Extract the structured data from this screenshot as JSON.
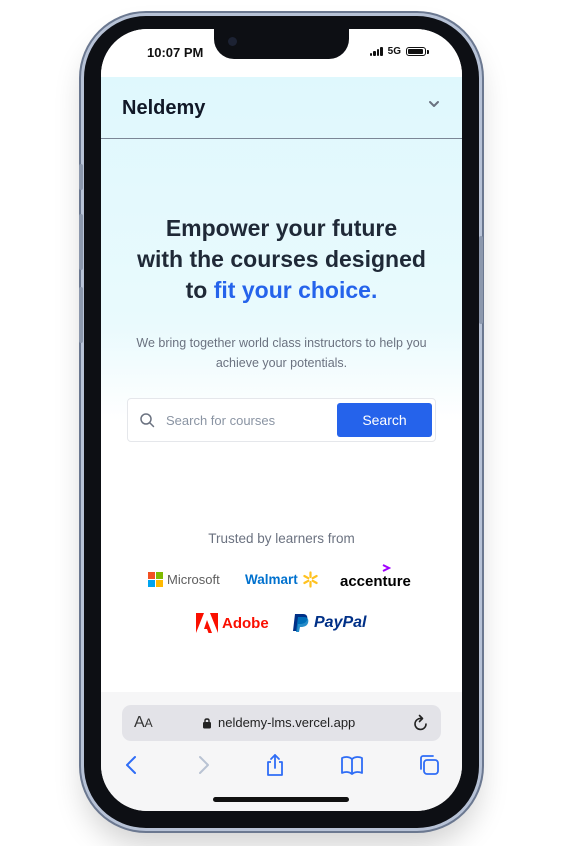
{
  "status_bar": {
    "time": "10:07 PM",
    "network": "5G"
  },
  "header": {
    "brand": "Neldemy"
  },
  "hero": {
    "title_line1": "Empower your future",
    "title_line2": "with the courses designed",
    "title_line3_prefix": "to ",
    "title_line3_accent": "fit your choice.",
    "subtitle": "We bring together world class instructors to help you achieve your potentials."
  },
  "search": {
    "placeholder": "Search for courses",
    "button_label": "Search"
  },
  "trusted": {
    "label": "Trusted by learners from",
    "logos": [
      "Microsoft",
      "Walmart",
      "accenture",
      "Adobe",
      "PayPal"
    ]
  },
  "browser": {
    "aa_label": "A",
    "aa_small": "A",
    "url": "neldemy-lms.vercel.app"
  },
  "colors": {
    "accent": "#2563eb",
    "hero_bg": "#dff8fd",
    "text_dark": "#1f2937"
  },
  "icons": [
    "chevron-down-icon",
    "search-icon",
    "lock-icon",
    "reload-icon",
    "back-icon",
    "forward-icon",
    "share-icon",
    "bookmarks-icon",
    "tabs-icon"
  ]
}
